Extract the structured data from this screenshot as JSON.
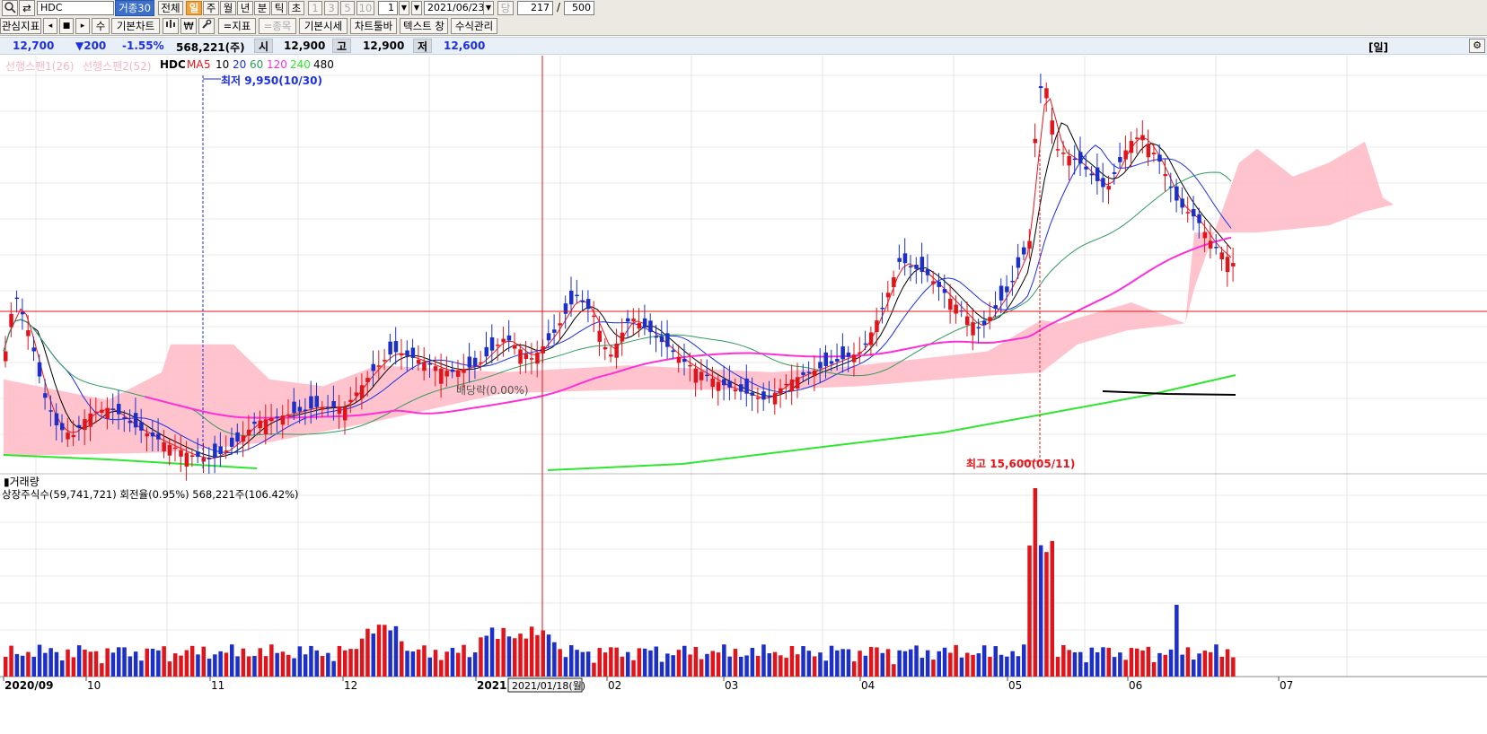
{
  "toolbar1": {
    "symbol": "HDC",
    "trade_btn": "거종30",
    "periods": [
      "전체",
      "일",
      "주",
      "월",
      "년",
      "분",
      "틱",
      "초",
      "1",
      "3",
      "5",
      "10"
    ],
    "period_active": "일",
    "unit_value": "1",
    "date_value": "2021/06/23",
    "count_label": "당",
    "count_value": "217",
    "count_sep": "/",
    "count_total": "500"
  },
  "toolbar2": {
    "buttons": [
      "관심지표",
      "수",
      "기본차트",
      "=지표",
      "=종목",
      "기본시세",
      "차트툴바",
      "텍스트 창",
      "수식관리"
    ]
  },
  "quote": {
    "price": "12,700",
    "change": "▼200",
    "change_pct": "-1.55%",
    "volume": "568,221(주)",
    "open_label": "시",
    "open": "12,900",
    "high_label": "고",
    "high": "12,900",
    "low_label": "저",
    "low": "12,600",
    "period_tag": "[일]"
  },
  "legend": {
    "span1": "선행스팬1(26)",
    "span2": "선행스팬2(52)",
    "symbol": "HDC",
    "ma_label": "MA",
    "ma_periods": [
      "5",
      "10",
      "20",
      "60",
      "120",
      "240",
      "480"
    ]
  },
  "annotations": {
    "low": "최저 9,950(10/30)",
    "high": "최고 15,600(05/11)",
    "dividend": "배당락(0.00%)"
  },
  "volume_panel": {
    "title": "거래량",
    "info": "상장주식수(59,741,721) 회전율(0.95%) 568,221주(106.42%)"
  },
  "axis": {
    "date_labels": [
      "2020/09",
      "10",
      "11",
      "12",
      "2021",
      "02",
      "03",
      "04",
      "05",
      "06",
      "07"
    ],
    "crosshair_date": "2021/01/18(월)"
  },
  "colors": {
    "up": "#e0141a",
    "down": "#1c2fc8",
    "ma5": "#e8141a",
    "ma10": "#000000",
    "ma20": "#1a2fe6",
    "ma60": "#2f9a5c",
    "ma120": "#ff2fd8",
    "ma240": "#2ee62e",
    "ma480": "#000000",
    "cloud": "#ffc0cb",
    "crosshair": "#e6141a"
  },
  "chart_data": {
    "type": "candlestick",
    "symbol": "HDC",
    "x_range": [
      "2020/09",
      "2021/07"
    ],
    "ylim": [
      9950,
      15600
    ],
    "overlays": [
      "MA5",
      "MA10",
      "MA20",
      "MA60",
      "MA120",
      "MA240",
      "MA480",
      "선행스팬1(26)",
      "선행스팬2(52)"
    ],
    "last": {
      "date": "2021/06/23",
      "open": 12900,
      "high": 12900,
      "low": 12600,
      "close": 12700,
      "volume": 568221
    },
    "low_marker": {
      "date": "10/30",
      "value": 9950
    },
    "high_marker": {
      "date": "05/11",
      "value": 15600
    }
  }
}
